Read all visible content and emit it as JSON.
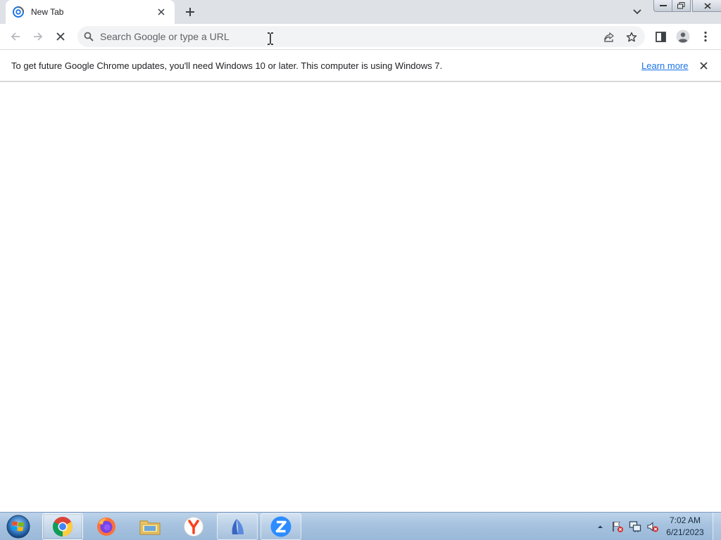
{
  "browser": {
    "tab": {
      "title": "New Tab"
    },
    "omnibox": {
      "placeholder": "Search Google or type a URL",
      "value": ""
    },
    "infobar": {
      "message": "To get future Google Chrome updates, you'll need Windows 10 or later. This computer is using Windows 7.",
      "link": "Learn more"
    }
  },
  "taskbar": {
    "apps": [
      {
        "name": "chrome",
        "active": true
      },
      {
        "name": "firefox"
      },
      {
        "name": "file-explorer"
      },
      {
        "name": "yandex-browser"
      },
      {
        "name": "sail-app"
      },
      {
        "name": "zoom"
      }
    ],
    "clock": {
      "time": "7:02 AM",
      "date": "6/21/2023"
    }
  },
  "colors": {
    "tabstrip": "#dee1e6",
    "omnibox": "#f1f3f4",
    "link": "#1a73e8",
    "taskbar": "#a6c2df"
  }
}
